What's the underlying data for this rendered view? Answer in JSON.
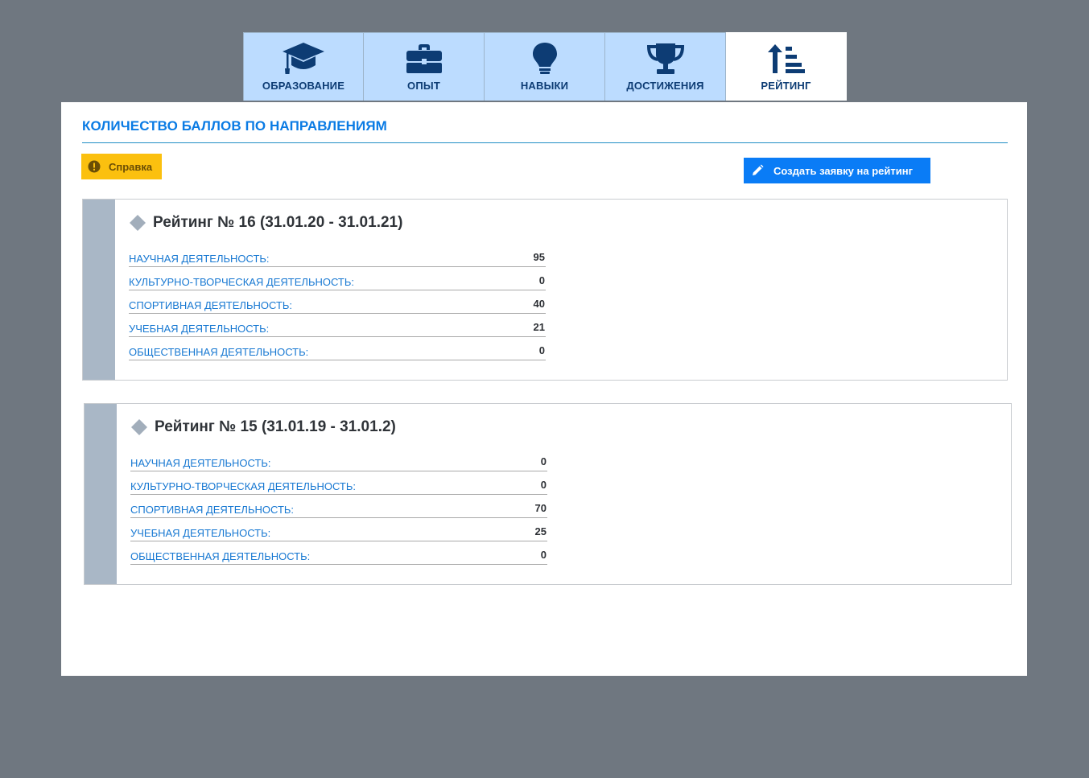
{
  "tabs": [
    {
      "label": "ОБРАЗОВАНИЕ",
      "icon": "graduation-cap-icon",
      "active": false
    },
    {
      "label": "ОПЫТ",
      "icon": "briefcase-icon",
      "active": false
    },
    {
      "label": "НАВЫКИ",
      "icon": "lightbulb-icon",
      "active": false
    },
    {
      "label": "ДОСТИЖЕНИЯ",
      "icon": "trophy-icon",
      "active": false
    },
    {
      "label": "РЕЙТИНГ",
      "icon": "sort-amount-up-icon",
      "active": true
    }
  ],
  "section": {
    "title": "КОЛИЧЕСТВО БАЛЛОВ ПО НАПРАВЛЕНИЯМ"
  },
  "help_button": {
    "label": "Справка",
    "icon": "exclamation-circle-icon"
  },
  "create_button": {
    "label": "Создать заявку на рейтинг",
    "icon": "pencil-icon"
  },
  "ratings": [
    {
      "title": "Рейтинг № 16 (31.01.20 - 31.01.21)",
      "rows": [
        {
          "label": "НАУЧНАЯ ДЕЯТЕЛЬНОСТЬ:",
          "value": "95"
        },
        {
          "label": "КУЛЬТУРНО-ТВОРЧЕСКАЯ ДЕЯТЕЛЬНОСТЬ:",
          "value": "0"
        },
        {
          "label": "СПОРТИВНАЯ ДЕЯТЕЛЬНОСТЬ:",
          "value": "40"
        },
        {
          "label": "УЧЕБНАЯ ДЕЯТЕЛЬНОСТЬ:",
          "value": "21"
        },
        {
          "label": "ОБЩЕСТВЕННАЯ ДЕЯТЕЛЬНОСТЬ:",
          "value": "0"
        }
      ]
    },
    {
      "title": "Рейтинг № 15 (31.01.19 - 31.01.2)",
      "rows": [
        {
          "label": "НАУЧНАЯ ДЕЯТЕЛЬНОСТЬ:",
          "value": "0"
        },
        {
          "label": "КУЛЬТУРНО-ТВОРЧЕСКАЯ ДЕЯТЕЛЬНОСТЬ:",
          "value": "0"
        },
        {
          "label": "СПОРТИВНАЯ ДЕЯТЕЛЬНОСТЬ:",
          "value": "70"
        },
        {
          "label": "УЧЕБНАЯ ДЕЯТЕЛЬНОСТЬ:",
          "value": "25"
        },
        {
          "label": "ОБЩЕСТВЕННАЯ ДЕЯТЕЛЬНОСТЬ:",
          "value": "0"
        }
      ]
    }
  ],
  "colors": {
    "background": "#6f7780",
    "tab_inactive": "#bcdcff",
    "tab_text": "#0d3c74",
    "accent": "#0a7be4",
    "help_yellow": "#fbc00f",
    "create_blue": "#0a7cf6",
    "card_stripe": "#a9b7c6"
  }
}
